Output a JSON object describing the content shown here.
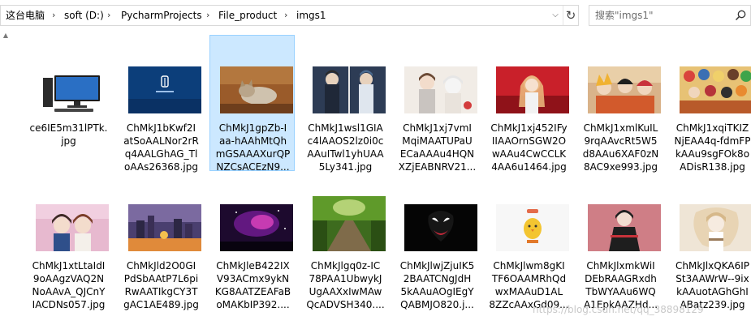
{
  "address_bar": {
    "crumbs": [
      "这台电脑",
      "soft (D:)",
      "PycharmProjects",
      "File_product",
      "imgs1"
    ],
    "separator": "›"
  },
  "search": {
    "placeholder": "搜索\"imgs1\""
  },
  "files": [
    {
      "name": "ce6IE5m31lPTk.\njpg",
      "thumb": "computer"
    },
    {
      "name": "ChMkJ1bKwf2I\natSoAALNor2rR\nq4AALGhAG_Tl\noAAs26368.jpg",
      "thumb": "blue-logo"
    },
    {
      "name": "ChMkJ1gpZb-I\naa-hAAhMtQh\nmGSAAAXurQP\nNZCsACEzN9...",
      "thumb": "kitten",
      "selected": true
    },
    {
      "name": "ChMkJ1wsl1GIA\nc4lAAOS2lz0i0c\nAAuITwl1yhUAA\n5Ly341.jpg",
      "thumb": "anime-duo"
    },
    {
      "name": "ChMkJ1xj7vmI\nMqiMAATUPaU\nECaAAAu4HQN\nXZjEABNRV21...",
      "thumb": "anime-light"
    },
    {
      "name": "ChMkJ1xj452IFy\nIIAAOrnSGW2O\nwAAu4CwCCLK\n4AA6u1464.jpg",
      "thumb": "anime-red"
    },
    {
      "name": "ChMkJ1xmlKuIL\n9rqAAvcRt5W5\nd8AAu6XAF0zN\n8AC9xe993.jpg",
      "thumb": "anime-group"
    },
    {
      "name": "ChMkJ1xqiTKIZ\nNjEAA4q-fdmFP\nkAAu9sgFOk8o\nADisR138.jpg",
      "thumb": "anime-crowd"
    },
    {
      "name": "ChMkJ1xtLtaIdI\n9oAAgzVAQ2N\nNoAAvA_QJCnY\nIACDNs057.jpg",
      "thumb": "anime-couple"
    },
    {
      "name": "ChMkJld2O0GI\nPdSbAAtP7L6pi\nRwAATIkgCY3T\ngAC1AE489.jpg",
      "thumb": "fantasy-city"
    },
    {
      "name": "ChMkJleB422IX\nV93ACmx9ykN\nKG8AATZEAFaB\noMAKbIP392....",
      "thumb": "purple-sky"
    },
    {
      "name": "ChMkJlgq0z-IC\n78PAA1UbwykJ\nUgAAXxIwMAw\nQcADVSH340....",
      "thumb": "forest-road"
    },
    {
      "name": "ChMkJlwjZjuIK5\n2BAATCNgJdH\n5kAAuAOgIEgY\nQABMJO820.j...",
      "thumb": "dark-venom"
    },
    {
      "name": "ChMkJlwm8gKI\nTF6OAAMRhQd\nwxMAAuD1AL\n8ZZcAAxGd09...",
      "thumb": "cute-chick"
    },
    {
      "name": "ChMkJlxmkWiI\nDEbRAAGRxdh\nTbWYAAu6WQ\nA1EpkAAZHd...",
      "thumb": "anime-pink"
    },
    {
      "name": "ChMkJlxQKA6IP\nSt3AAWrW--9ix\nkAAuotAGhGhI\nABatz239.jpg",
      "thumb": "anime-sketch"
    }
  ],
  "watermark": "https://blog.csdn.net/qq_38898129",
  "colors": {
    "selection_bg": "#cce8ff",
    "selection_border": "#99d1ff"
  }
}
